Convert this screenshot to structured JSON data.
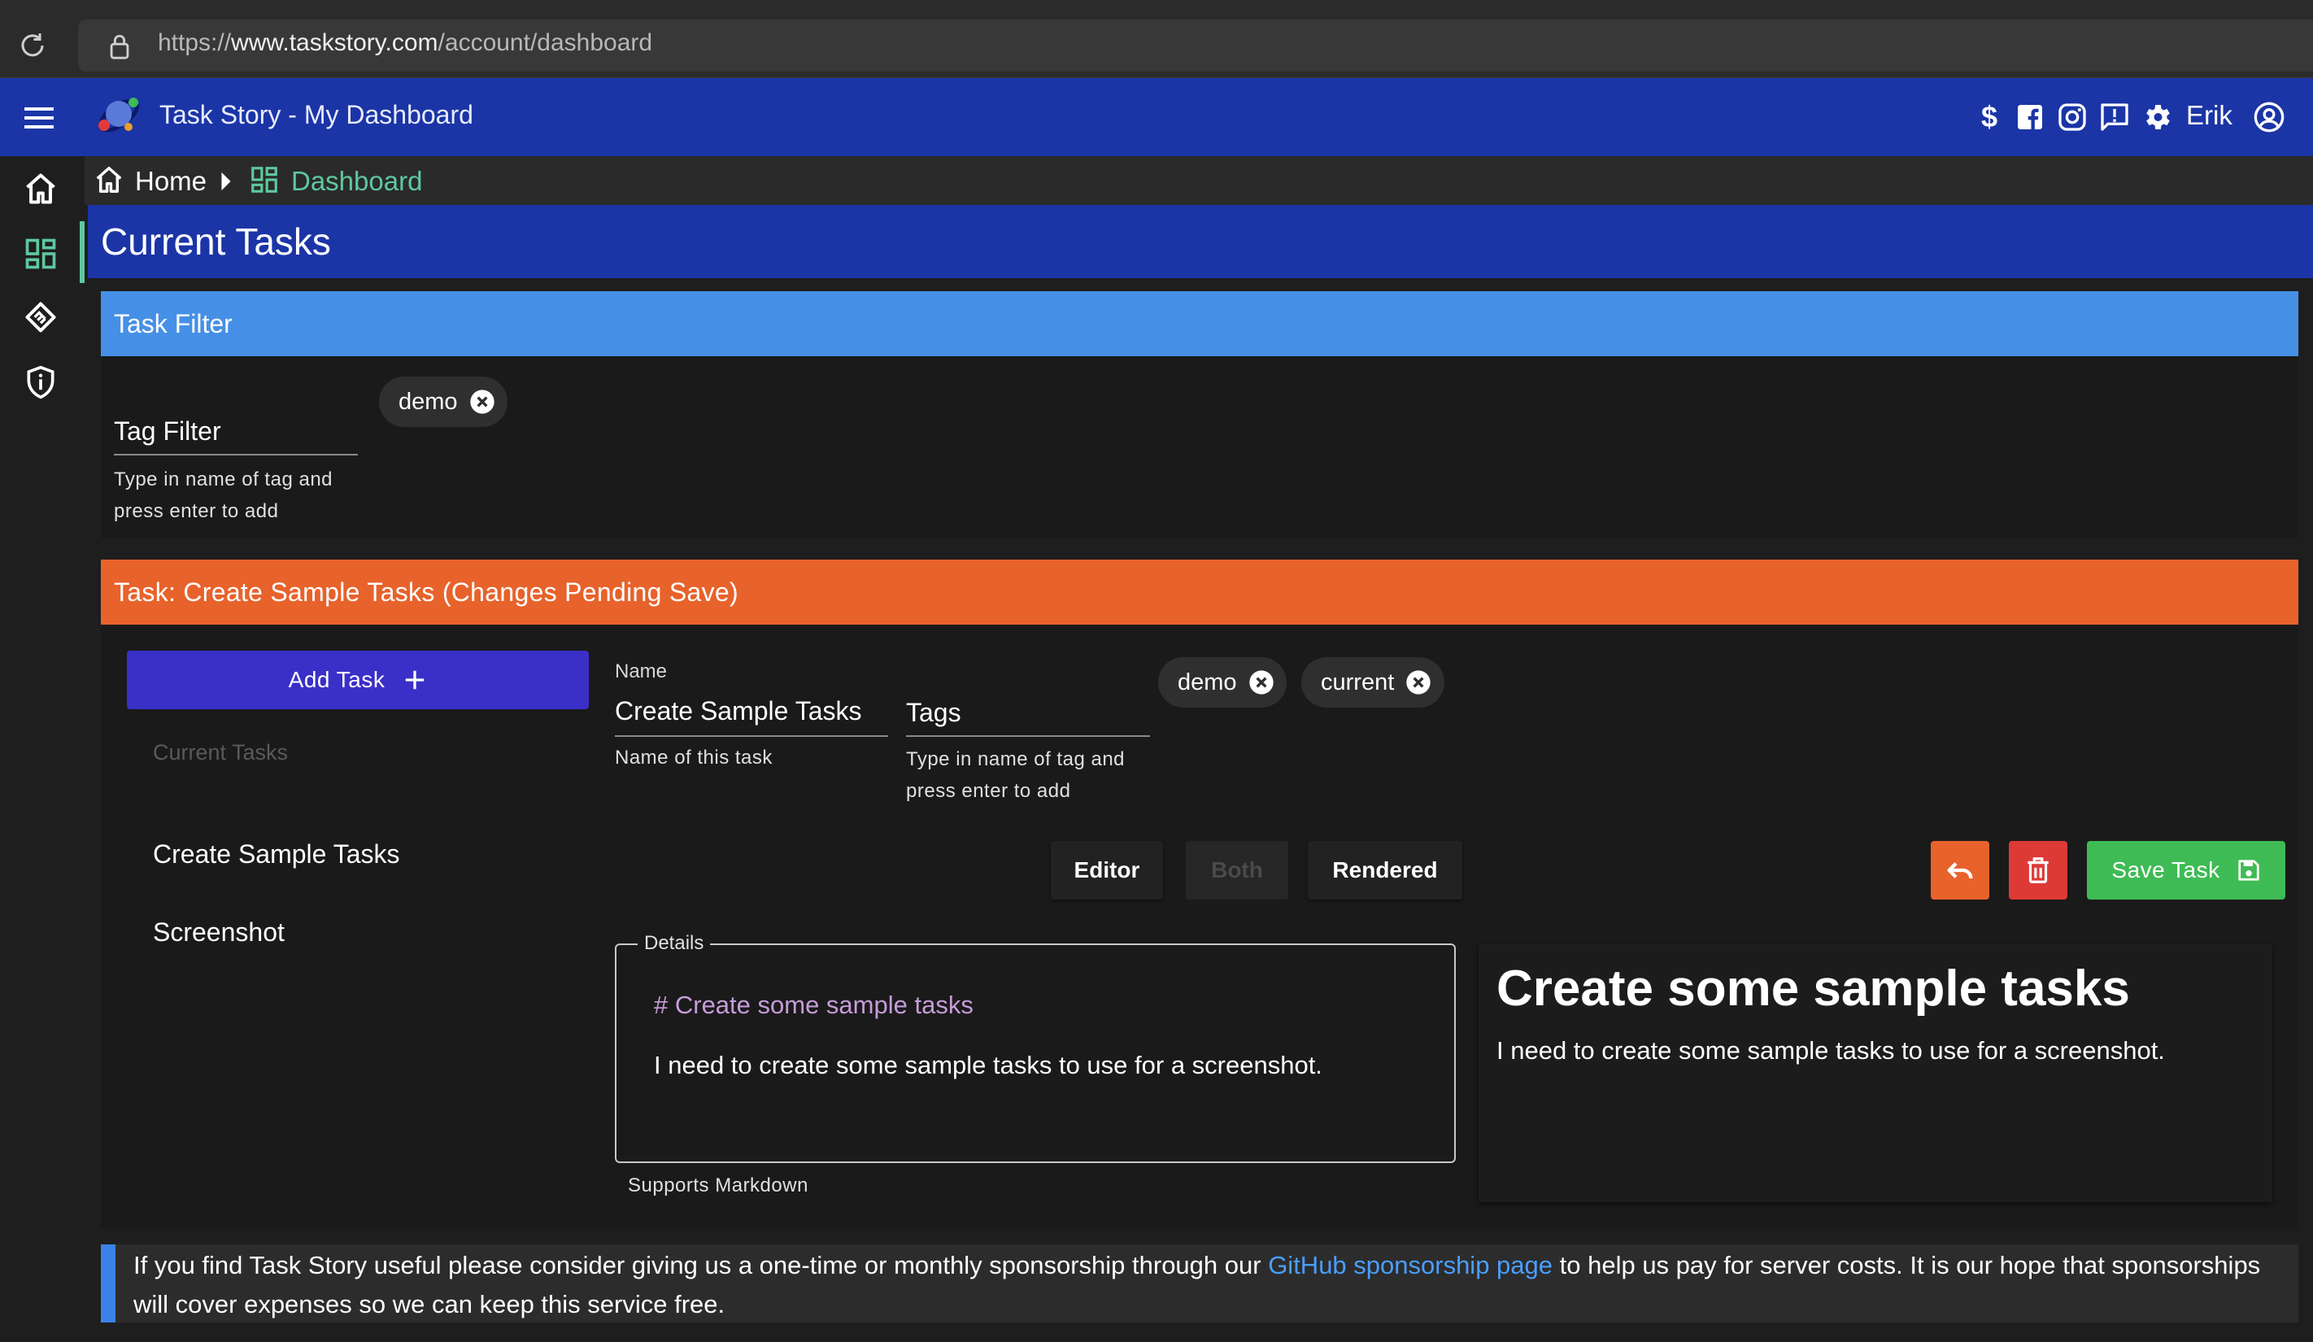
{
  "browser": {
    "url_scheme": "https://",
    "url_host": "www.taskstory.com",
    "url_path": "/account/dashboard"
  },
  "appbar": {
    "title": "Task Story - My Dashboard",
    "dollar": "$",
    "user_name": "Erik",
    "icons": [
      "menu-icon",
      "logo",
      "dollar-icon",
      "facebook-icon",
      "instagram-icon",
      "feedback-icon",
      "gear-icon",
      "account-icon"
    ]
  },
  "breadcrumb": {
    "home": "Home",
    "current": "Dashboard"
  },
  "page": {
    "title": "Current Tasks"
  },
  "filter": {
    "header": "Task Filter",
    "label": "Tag Filter",
    "help": "Type in name of tag and press enter to add",
    "chips": [
      "demo"
    ]
  },
  "task": {
    "header": "Task: Create Sample Tasks (Changes Pending Save)",
    "add_button": "Add Task",
    "list_label": "Current Tasks",
    "list": [
      "Create Sample Tasks",
      "Screenshot"
    ],
    "name_label": "Name",
    "name_value": "Create Sample Tasks",
    "name_help": "Name of this task",
    "tags_label": "Tags",
    "tags_help": "Type in name of tag and press enter to add",
    "tag_chips": [
      "demo",
      "current"
    ],
    "view_modes": [
      "Editor",
      "Both",
      "Rendered"
    ],
    "selected_view": "Both",
    "save_button": "Save Task",
    "details_label": "Details",
    "details_heading_md": "# Create some sample tasks",
    "details_body_md": "I need to create some sample tasks to use for a screenshot.",
    "details_help": "Supports Markdown",
    "rendered_heading": "Create some sample tasks",
    "rendered_body": "I need to create some sample tasks to use for a screenshot."
  },
  "sponsor": {
    "text_before": "If you find Task Story useful please consider giving us a one-time or monthly sponsorship through our ",
    "link": "GitHub sponsorship page",
    "text_after": " to help us pay for server costs. It is our hope that sponsorships will cover expenses so we can keep this service free."
  },
  "colors": {
    "appbar": "#1b35a6",
    "filter_header": "#4590e6",
    "task_header": "#e8622b",
    "add_button": "#3a2fc7",
    "save_button": "#3fbb55",
    "delete_button": "#dd3a36",
    "accent": "#5ec8a0",
    "link": "#4a9eff"
  }
}
